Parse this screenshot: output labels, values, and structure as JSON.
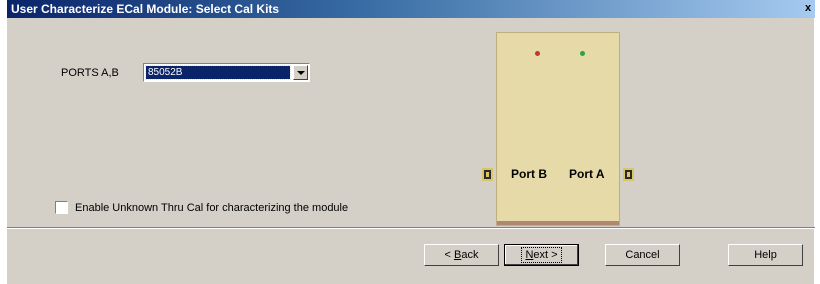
{
  "window": {
    "title": "User Characterize ECal Module: Select Cal Kits",
    "close_glyph": "x"
  },
  "ports": {
    "label": "PORTS A,B",
    "selected": "85052B"
  },
  "module": {
    "port_b_label": "Port B",
    "port_a_label": "Port A"
  },
  "checkbox": {
    "label": "Enable Unknown Thru Cal for characterizing the module",
    "checked": false
  },
  "buttons": {
    "back": {
      "mnemonic": "B",
      "before": "< ",
      "after": "ack"
    },
    "next": {
      "mnemonic": "N",
      "before": "",
      "after": "ext >"
    },
    "cancel": "Cancel",
    "help": "Help"
  },
  "colors": {
    "dialog_bg": "#d4d0c8",
    "module_bg": "#e6dba8",
    "selection_bg": "#0a246a",
    "led_red": "#c0392b",
    "led_green": "#2aa640"
  },
  "icons": {
    "dropdown": "chevron-down-icon",
    "port_connector": "port-connector-icon",
    "led": "led-icon"
  }
}
